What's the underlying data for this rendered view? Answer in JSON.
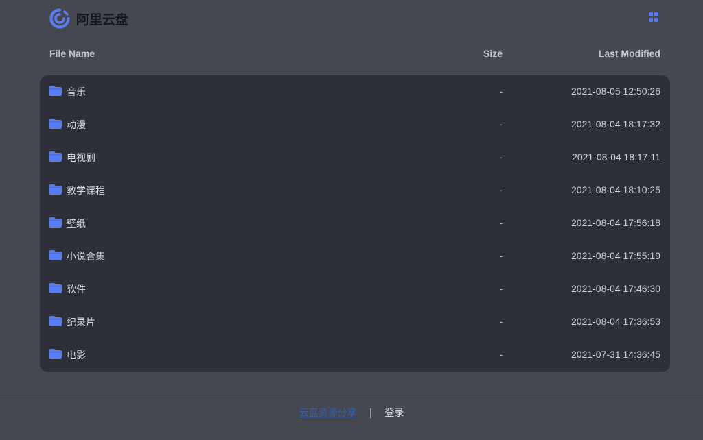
{
  "header": {
    "logo_text": "阿里云盘"
  },
  "columns": {
    "name": "File Name",
    "size": "Size",
    "modified": "Last Modified"
  },
  "files": [
    {
      "name": "音乐",
      "size": "-",
      "modified": "2021-08-05 12:50:26"
    },
    {
      "name": "动漫",
      "size": "-",
      "modified": "2021-08-04 18:17:32"
    },
    {
      "name": "电视剧",
      "size": "-",
      "modified": "2021-08-04 18:17:11"
    },
    {
      "name": "教学课程",
      "size": "-",
      "modified": "2021-08-04 18:10:25"
    },
    {
      "name": "壁纸",
      "size": "-",
      "modified": "2021-08-04 17:56:18"
    },
    {
      "name": "小说合集",
      "size": "-",
      "modified": "2021-08-04 17:55:19"
    },
    {
      "name": "软件",
      "size": "-",
      "modified": "2021-08-04 17:46:30"
    },
    {
      "name": "纪录片",
      "size": "-",
      "modified": "2021-08-04 17:36:53"
    },
    {
      "name": "电影",
      "size": "-",
      "modified": "2021-07-31 14:36:45"
    }
  ],
  "footer": {
    "link_text": "云盘资源分享",
    "separator": "|",
    "login_text": "登录"
  },
  "colors": {
    "accent": "#5b7cf0",
    "background": "#454851",
    "panel": "#2d3039"
  },
  "icons": {
    "logo": "aliyun-drive-logo-icon",
    "view_toggle": "grid-view-icon",
    "folder": "folder-icon"
  }
}
